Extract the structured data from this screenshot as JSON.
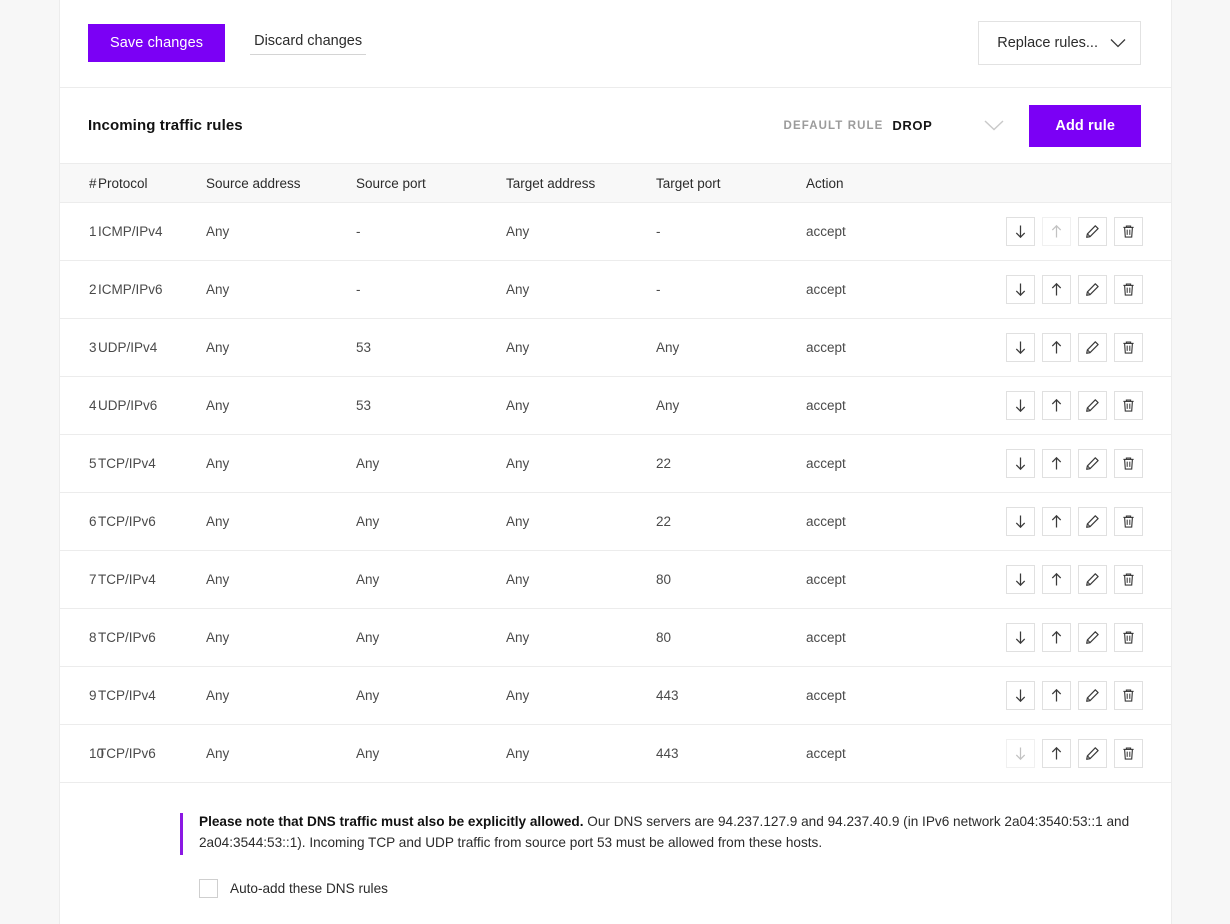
{
  "actionbar": {
    "save_label": "Save changes",
    "discard_label": "Discard changes",
    "replace_label": "Replace rules...",
    "chevron_icon": "chevron-down-icon"
  },
  "section": {
    "title": "Incoming traffic rules",
    "default_rule_label": "DEFAULT RULE",
    "default_rule_value": "DROP",
    "default_rule_chevron_icon": "chevron-down-icon",
    "add_rule_label": "Add rule"
  },
  "table": {
    "columns": [
      "#",
      "Protocol",
      "Source address",
      "Source port",
      "Target address",
      "Target port",
      "Action"
    ],
    "row_ops": {
      "move_down_icon": "arrow-down-icon",
      "move_up_icon": "arrow-up-icon",
      "edit_icon": "pencil-icon",
      "delete_icon": "trash-icon"
    },
    "rows": [
      {
        "num": "1",
        "protocol": "ICMP/IPv4",
        "source_address": "Any",
        "source_port": "-",
        "target_address": "Any",
        "target_port": "-",
        "action": "accept",
        "can_move_down": true,
        "can_move_up": false
      },
      {
        "num": "2",
        "protocol": "ICMP/IPv6",
        "source_address": "Any",
        "source_port": "-",
        "target_address": "Any",
        "target_port": "-",
        "action": "accept",
        "can_move_down": true,
        "can_move_up": true
      },
      {
        "num": "3",
        "protocol": "UDP/IPv4",
        "source_address": "Any",
        "source_port": "53",
        "target_address": "Any",
        "target_port": "Any",
        "action": "accept",
        "can_move_down": true,
        "can_move_up": true
      },
      {
        "num": "4",
        "protocol": "UDP/IPv6",
        "source_address": "Any",
        "source_port": "53",
        "target_address": "Any",
        "target_port": "Any",
        "action": "accept",
        "can_move_down": true,
        "can_move_up": true
      },
      {
        "num": "5",
        "protocol": "TCP/IPv4",
        "source_address": "Any",
        "source_port": "Any",
        "target_address": "Any",
        "target_port": "22",
        "action": "accept",
        "can_move_down": true,
        "can_move_up": true
      },
      {
        "num": "6",
        "protocol": "TCP/IPv6",
        "source_address": "Any",
        "source_port": "Any",
        "target_address": "Any",
        "target_port": "22",
        "action": "accept",
        "can_move_down": true,
        "can_move_up": true
      },
      {
        "num": "7",
        "protocol": "TCP/IPv4",
        "source_address": "Any",
        "source_port": "Any",
        "target_address": "Any",
        "target_port": "80",
        "action": "accept",
        "can_move_down": true,
        "can_move_up": true
      },
      {
        "num": "8",
        "protocol": "TCP/IPv6",
        "source_address": "Any",
        "source_port": "Any",
        "target_address": "Any",
        "target_port": "80",
        "action": "accept",
        "can_move_down": true,
        "can_move_up": true
      },
      {
        "num": "9",
        "protocol": "TCP/IPv4",
        "source_address": "Any",
        "source_port": "Any",
        "target_address": "Any",
        "target_port": "443",
        "action": "accept",
        "can_move_down": true,
        "can_move_up": true
      },
      {
        "num": "10",
        "protocol": "TCP/IPv6",
        "source_address": "Any",
        "source_port": "Any",
        "target_address": "Any",
        "target_port": "443",
        "action": "accept",
        "can_move_down": false,
        "can_move_up": true
      }
    ]
  },
  "note": {
    "bold_text": "Please note that DNS traffic must also be explicitly allowed.",
    "rest_text": " Our DNS servers are 94.237.127.9 and 94.237.40.9 (in IPv6 network 2a04:3540:53::1 and 2a04:3544:53::1). Incoming TCP and UDP traffic from source port 53 must be allowed from these hosts.",
    "checkbox_label": "Auto-add these DNS rules",
    "checkbox_checked": false
  },
  "colors": {
    "accent_purple": "#7b00f5",
    "note_bar_purple": "#8b18e3",
    "header_bg": "#f8f8f8",
    "border": "#ececec",
    "page_bg": "#f7f7f7"
  }
}
